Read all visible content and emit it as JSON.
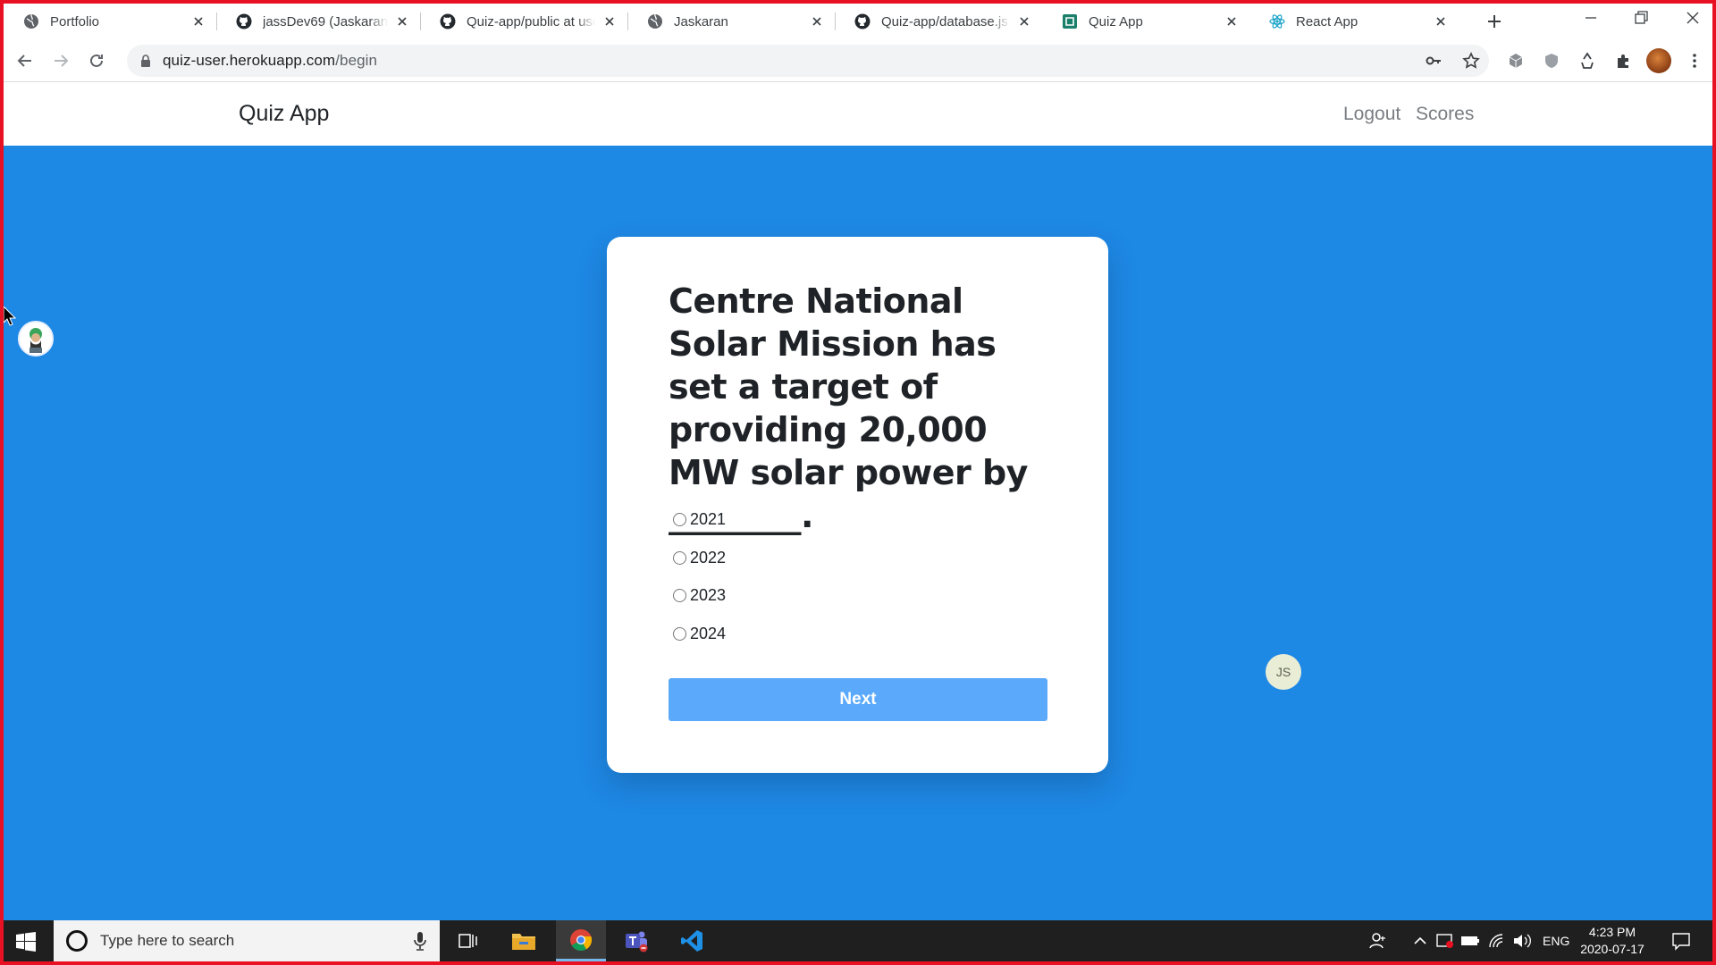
{
  "browser": {
    "tabs": [
      {
        "title": "Portfolio",
        "favicon": "globe-icon",
        "active": false
      },
      {
        "title": "jassDev69 (Jaskaran)",
        "favicon": "github-icon",
        "active": false
      },
      {
        "title": "Quiz-app/public at use",
        "favicon": "github-icon",
        "active": false
      },
      {
        "title": "Jaskaran",
        "favicon": "globe-icon",
        "active": false
      },
      {
        "title": "Quiz-app/database.js a",
        "favicon": "github-icon",
        "active": false
      },
      {
        "title": "Quiz App",
        "favicon": "quiz-app-icon",
        "active": true
      },
      {
        "title": "React App",
        "favicon": "react-icon",
        "active": false
      }
    ],
    "url": {
      "host": "quiz-user.herokuapp.com",
      "path": "/begin"
    }
  },
  "app": {
    "brand": "Quiz App",
    "nav": {
      "logout": "Logout",
      "scores": "Scores"
    }
  },
  "quiz": {
    "question": "Centre National Solar Mission has set a target of providing 20,000 MW solar power by ________.",
    "options": [
      "2021",
      "2022",
      "2023",
      "2024"
    ],
    "selected": null,
    "next_label": "Next"
  },
  "badges": {
    "initials": "JS"
  },
  "taskbar": {
    "search_placeholder": "Type here to search",
    "language": "ENG",
    "time": "4:23 PM",
    "date": "2020-07-17"
  },
  "colors": {
    "page_bg": "#1e88e5",
    "button_bg": "#5aa9fa",
    "window_border": "#e81123"
  }
}
